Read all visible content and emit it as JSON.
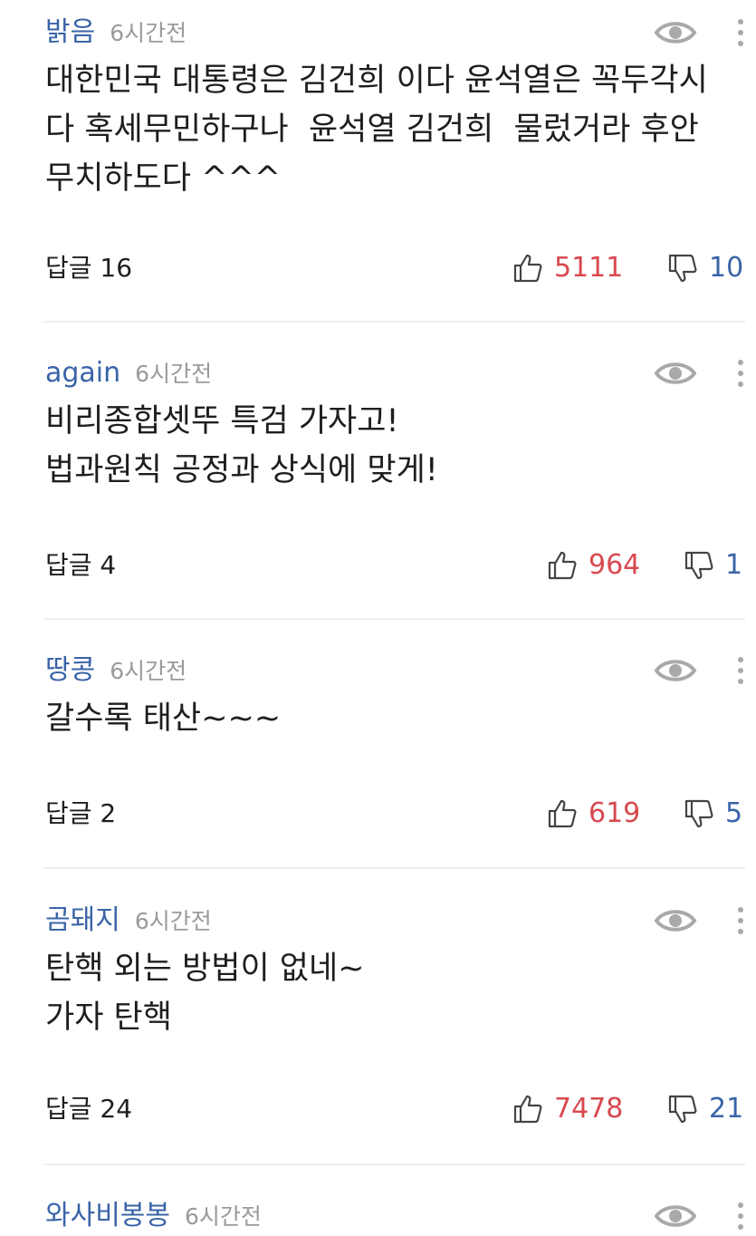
{
  "colors": {
    "nickname": "#3a64a8",
    "time": "#9a9a9a",
    "like": "#d8494f",
    "dislike": "#3a64a8",
    "divider": "#eeeeee"
  },
  "icons": {
    "view": "eye-icon",
    "more": "more-vertical-icon",
    "like": "thumbs-up-icon",
    "dislike": "thumbs-down-icon"
  },
  "comments": [
    {
      "nickname": "밝음",
      "time": "6시간전",
      "body": "대한민국 대통령은 김건희 이다 윤석열은 꼭두각시\n다 혹세무민하구나  윤석열 김건희  물렀거라 후안\n무치하도다 ^^^",
      "reply_label": "답글 16",
      "likes": "5111",
      "dislikes": "10"
    },
    {
      "nickname": "again",
      "time": "6시간전",
      "body": "비리종합셋뚜 특검 가자고!\n법과원칙 공정과 상식에 맞게!",
      "reply_label": "답글 4",
      "likes": "964",
      "dislikes": "1"
    },
    {
      "nickname": "땅콩",
      "time": "6시간전",
      "body": "갈수록 태산~~~",
      "reply_label": "답글 2",
      "likes": "619",
      "dislikes": "5"
    },
    {
      "nickname": "곰돼지",
      "time": "6시간전",
      "body": "탄핵 외는 방법이 없네~\n가자 탄핵",
      "reply_label": "답글 24",
      "likes": "7478",
      "dislikes": "21"
    },
    {
      "nickname": "와사비봉봉",
      "time": "6시간전"
    }
  ]
}
